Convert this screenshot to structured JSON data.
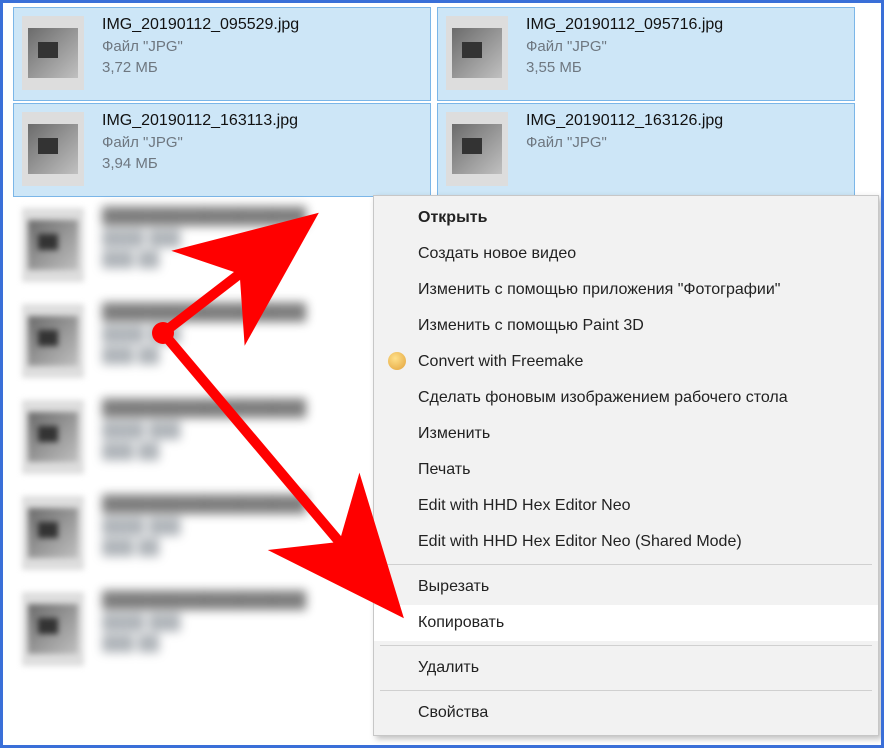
{
  "files": [
    {
      "name": "IMG_20190112_095529.jpg",
      "type": "Файл \"JPG\"",
      "size": "3,72 МБ",
      "selected": true
    },
    {
      "name": "IMG_20190112_095716.jpg",
      "type": "Файл \"JPG\"",
      "size": "3,55 МБ",
      "selected": true
    },
    {
      "name": "IMG_20190112_163113.jpg",
      "type": "Файл \"JPG\"",
      "size": "3,94 МБ",
      "selected": true
    },
    {
      "name": "IMG_20190112_163126.jpg",
      "type": "Файл \"JPG\"",
      "size": "",
      "selected": true
    },
    {
      "name": "",
      "type": "",
      "size": "",
      "selected": false,
      "blur": true
    },
    {
      "name": "",
      "type": "",
      "size": "",
      "selected": false,
      "blur": true
    },
    {
      "name": "",
      "type": "",
      "size": "",
      "selected": false,
      "blur": true
    },
    {
      "name": "",
      "type": "",
      "size": "",
      "selected": false,
      "blur": true
    },
    {
      "name": "",
      "type": "",
      "size": "",
      "selected": false,
      "blur": true
    },
    {
      "name": "",
      "type": "",
      "size": "",
      "selected": false,
      "blur": true
    },
    {
      "name": "",
      "type": "",
      "size": "",
      "selected": false,
      "blur": true
    },
    {
      "name": "",
      "type": "",
      "size": "",
      "selected": false,
      "blur": true
    }
  ],
  "menu": {
    "open": "Открыть",
    "new_video": "Создать новое видео",
    "edit_photos": "Изменить с помощью приложения \"Фотографии\"",
    "edit_paint3d": "Изменить с помощью Paint 3D",
    "convert_freemake": "Convert with Freemake",
    "set_wallpaper": "Сделать фоновым изображением рабочего стола",
    "edit": "Изменить",
    "print": "Печать",
    "hex_neo": "Edit with HHD Hex Editor Neo",
    "hex_neo_shared": "Edit with HHD Hex Editor Neo (Shared Mode)",
    "cut": "Вырезать",
    "copy": "Копировать",
    "delete": "Удалить",
    "properties": "Свойства"
  }
}
